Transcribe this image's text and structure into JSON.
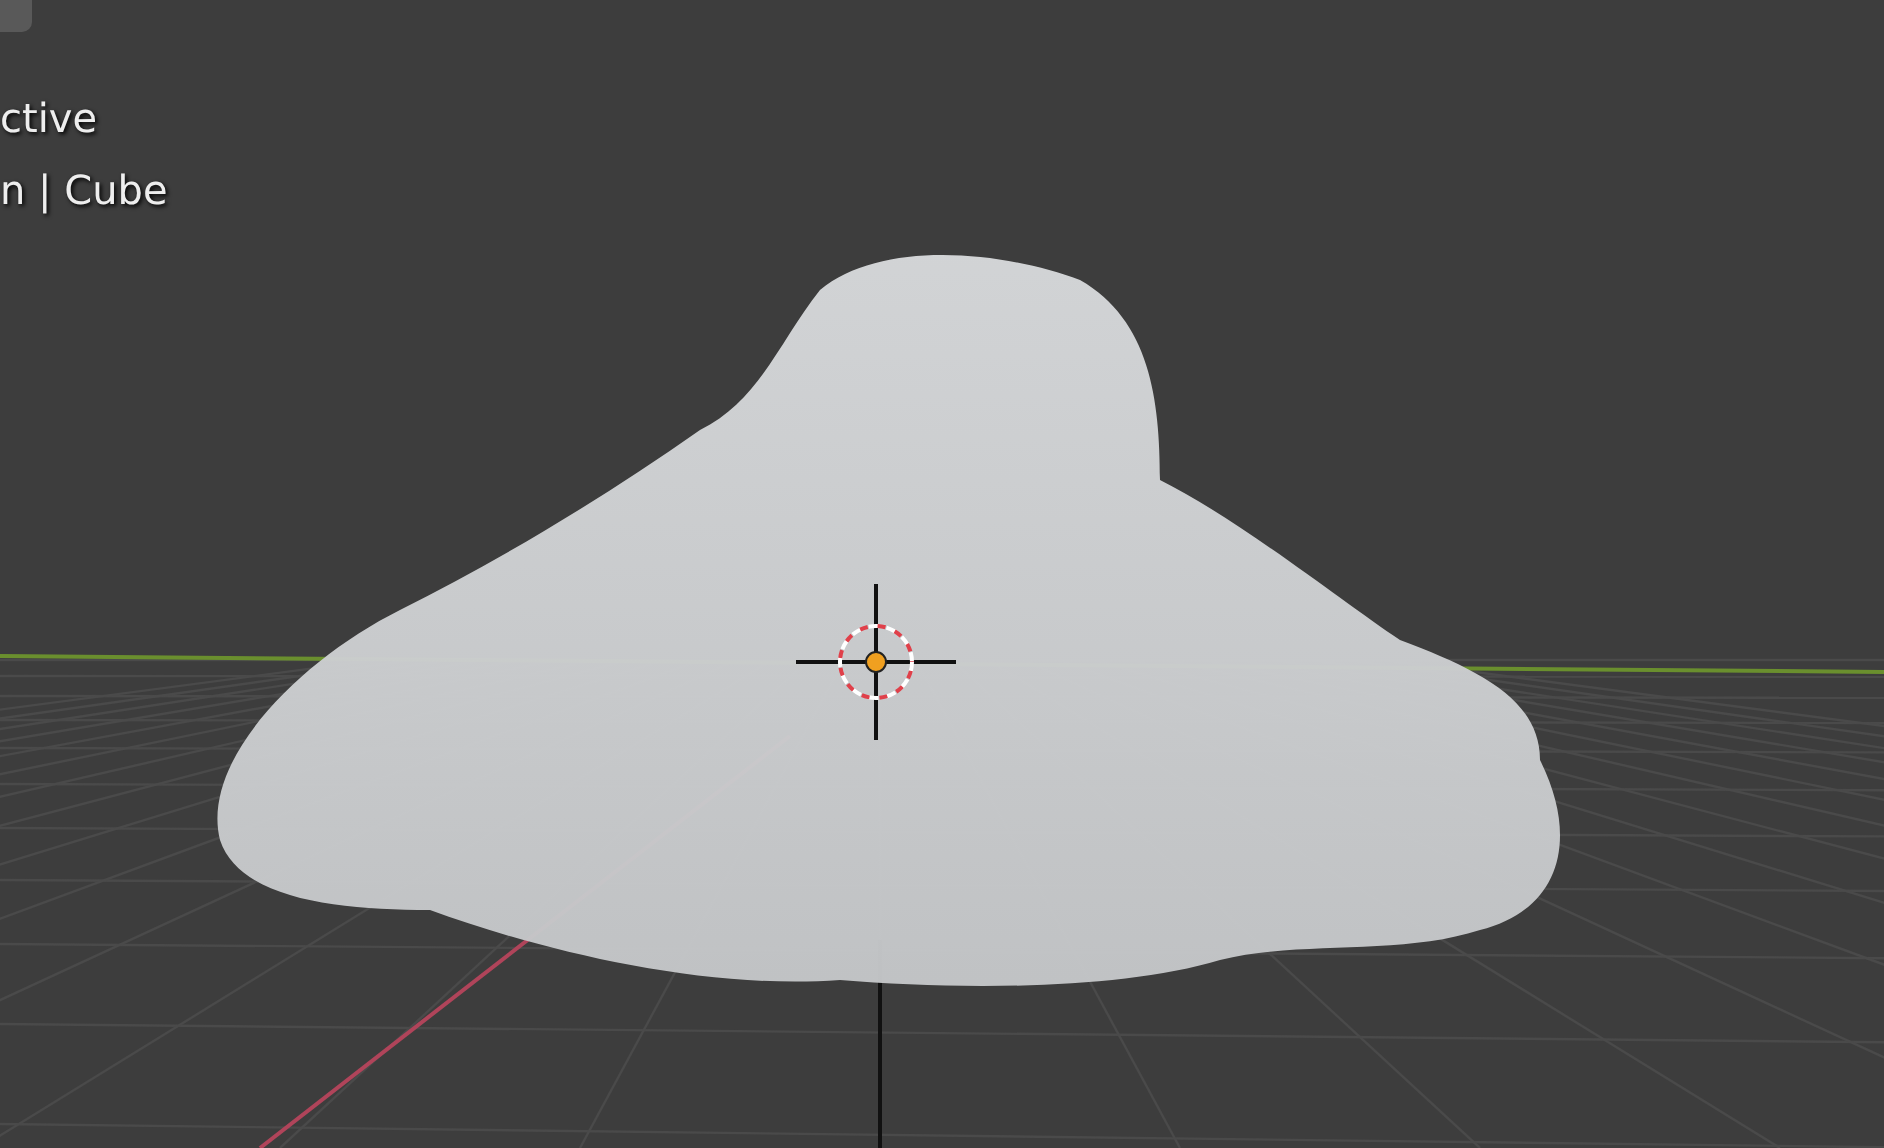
{
  "viewport": {
    "overlay_lines": [
      "ctive",
      "n | Cube"
    ]
  }
}
